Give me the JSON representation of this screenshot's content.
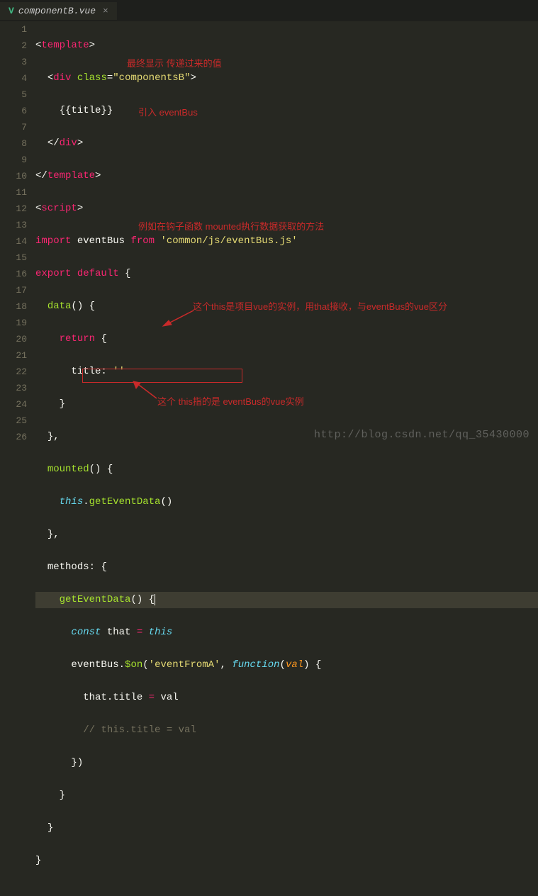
{
  "tab": {
    "filename": "componentB.vue",
    "icon": "V"
  },
  "lines": [
    "1",
    "2",
    "3",
    "4",
    "5",
    "6",
    "7",
    "8",
    "9",
    "10",
    "11",
    "12",
    "13",
    "14",
    "15",
    "16",
    "17",
    "18",
    "19",
    "20",
    "21",
    "22",
    "23",
    "24",
    "25",
    "26"
  ],
  "code": {
    "l3_interp": "{{title}}",
    "l2_class": "componentsB",
    "l7_import": "import",
    "l7_evt": "eventBus",
    "l7_from": "from",
    "l7_path": "'common/js/eventBus.js'",
    "l8_export": "export",
    "l8_default": "default",
    "l9_data": "data",
    "l10_return": "return",
    "l11_title": "title:",
    "l11_val": "''",
    "l14_mounted": "mounted",
    "l15_this": "this",
    "l15_get": "getEventData",
    "l17_methods": "methods:",
    "l18_get": "getEventData",
    "l19_const": "const",
    "l19_that": "that",
    "l19_this": "this",
    "l20_evt": "eventBus.",
    "l20_on": "$on",
    "l20_str": "'eventFromA'",
    "l20_fn": "function",
    "l20_val": "val",
    "l21_that": "that.title",
    "l21_val": "val",
    "l22_cmt": "// this.title = val"
  },
  "annotations": {
    "a1": "最终显示 传递过来的值",
    "a2": "引入 eventBus",
    "a3": "例如在钩子函数 mounted执行数据获取的方法",
    "a4": "这个this是项目vue的实例，用that接收，与eventBus的vue区分",
    "a5": "这个 this指的是 eventBus的vue实例"
  },
  "watermark": "http://blog.csdn.net/qq_35430000"
}
